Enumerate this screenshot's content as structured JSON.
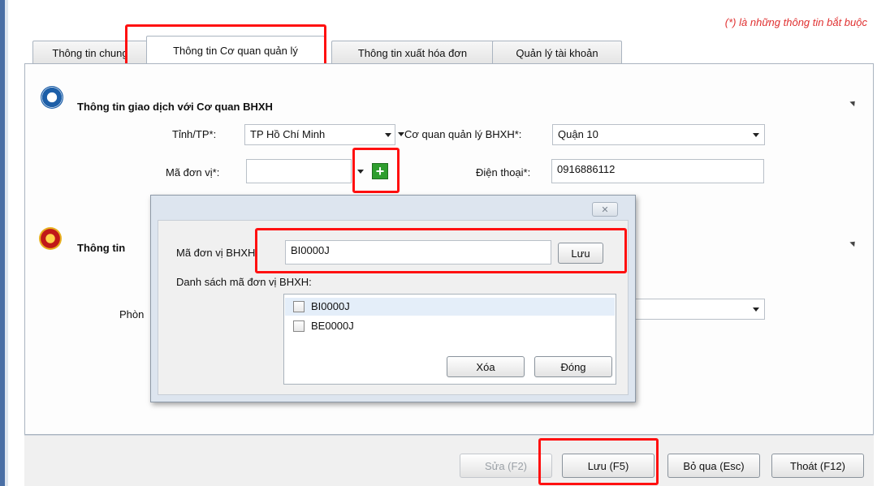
{
  "required_note": "(*) là những thông tin bắt buộc",
  "tabs": [
    {
      "label": "Thông tin chung"
    },
    {
      "label": "Thông tin Cơ quan quản lý"
    },
    {
      "label": "Thông tin xuất hóa đơn"
    },
    {
      "label": "Quản lý tài khoản"
    }
  ],
  "section1": {
    "title": "Thông tin giao dịch với Cơ quan BHXH",
    "province_label": "Tỉnh/TP*:",
    "province_value": "TP Hồ Chí Minh",
    "agency_label": "Cơ quan quản lý BHXH*:",
    "agency_value": "Quận 10",
    "unit_code_label": "Mã đơn vị*:",
    "unit_code_value": "",
    "phone_label": "Điện thoại*:",
    "phone_value": "0916886112"
  },
  "section2": {
    "title_partial": "Thông tin",
    "room_label_partial": "Phòn"
  },
  "dialog": {
    "close_symbol": "✕",
    "unit_label": "Mã đơn vị BHXH:",
    "unit_value": "BI0000J",
    "save_label": "Lưu",
    "list_label": "Danh sách mã đơn vị BHXH:",
    "items": [
      {
        "label": "BI0000J"
      },
      {
        "label": "BE0000J"
      }
    ],
    "delete_label": "Xóa",
    "close_label": "Đóng"
  },
  "footer": {
    "edit_label": "Sửa (F2)",
    "save_label": "Lưu (F5)",
    "skip_label": "Bỏ qua (Esc)",
    "exit_label": "Thoát (F12)"
  },
  "colors": {
    "highlight": "#ff1010",
    "required": "#e03030",
    "add_button": "#2f9e2f"
  }
}
